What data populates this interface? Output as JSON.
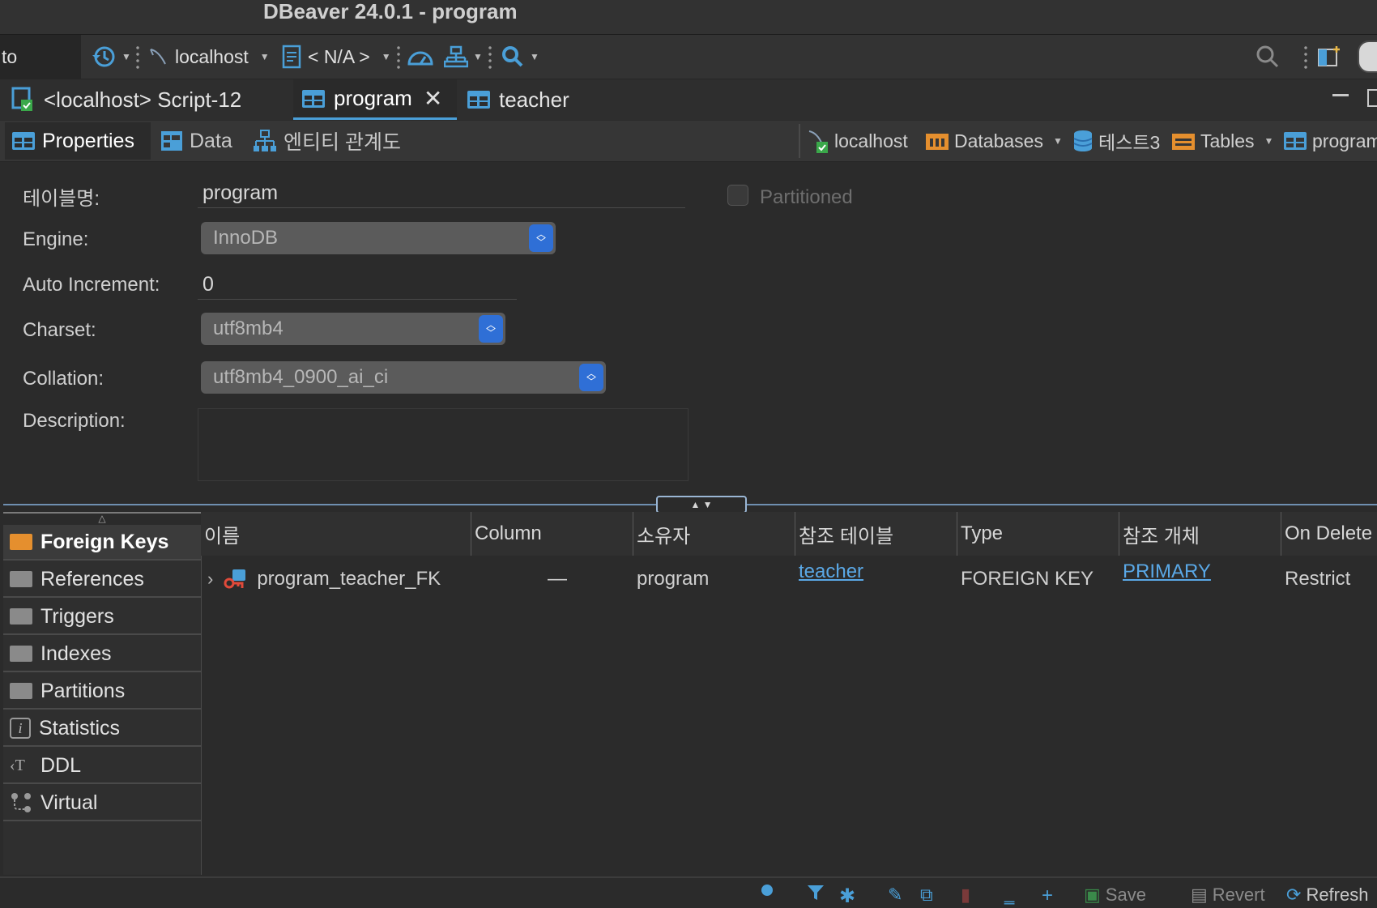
{
  "window": {
    "title": "DBeaver 24.0.1 - program"
  },
  "toolbar": {
    "search_stub": "to",
    "connection": "localhost",
    "schema": "< N/A >"
  },
  "editor_tabs": [
    {
      "label": "<localhost> Script-12"
    },
    {
      "label": "program"
    },
    {
      "label": "teacher"
    }
  ],
  "sub_tabs": [
    {
      "label": "Properties"
    },
    {
      "label": "Data"
    },
    {
      "label": "엔티티 관계도"
    }
  ],
  "breadcrumb": {
    "connection": "localhost",
    "databases": "Databases",
    "database": "테스트3",
    "tables": "Tables",
    "table": "program"
  },
  "properties": {
    "table_name_label": "테이블명:",
    "table_name": "program",
    "partitioned_label": "Partitioned",
    "engine_label": "Engine:",
    "engine": "InnoDB",
    "auto_increment_label": "Auto Increment:",
    "auto_increment": "0",
    "charset_label": "Charset:",
    "charset": "utf8mb4",
    "collation_label": "Collation:",
    "collation": "utf8mb4_0900_ai_ci",
    "description_label": "Description:"
  },
  "left_nav": [
    {
      "label": "Foreign Keys"
    },
    {
      "label": "References"
    },
    {
      "label": "Triggers"
    },
    {
      "label": "Indexes"
    },
    {
      "label": "Partitions"
    },
    {
      "label": "Statistics"
    },
    {
      "label": "DDL"
    },
    {
      "label": "Virtual"
    }
  ],
  "grid": {
    "headers": [
      "이름",
      "Column",
      "소유자",
      "참조 테이블",
      "Type",
      "참조 개체",
      "On Delete"
    ],
    "rows": [
      {
        "name": "program_teacher_FK",
        "column": "—",
        "owner": "program",
        "ref_table": "teacher",
        "type": "FOREIGN KEY",
        "ref_object": "PRIMARY",
        "on_delete": "Restrict"
      }
    ]
  },
  "statusbar": {
    "save": "Save",
    "revert": "Revert",
    "refresh": "Refresh"
  }
}
